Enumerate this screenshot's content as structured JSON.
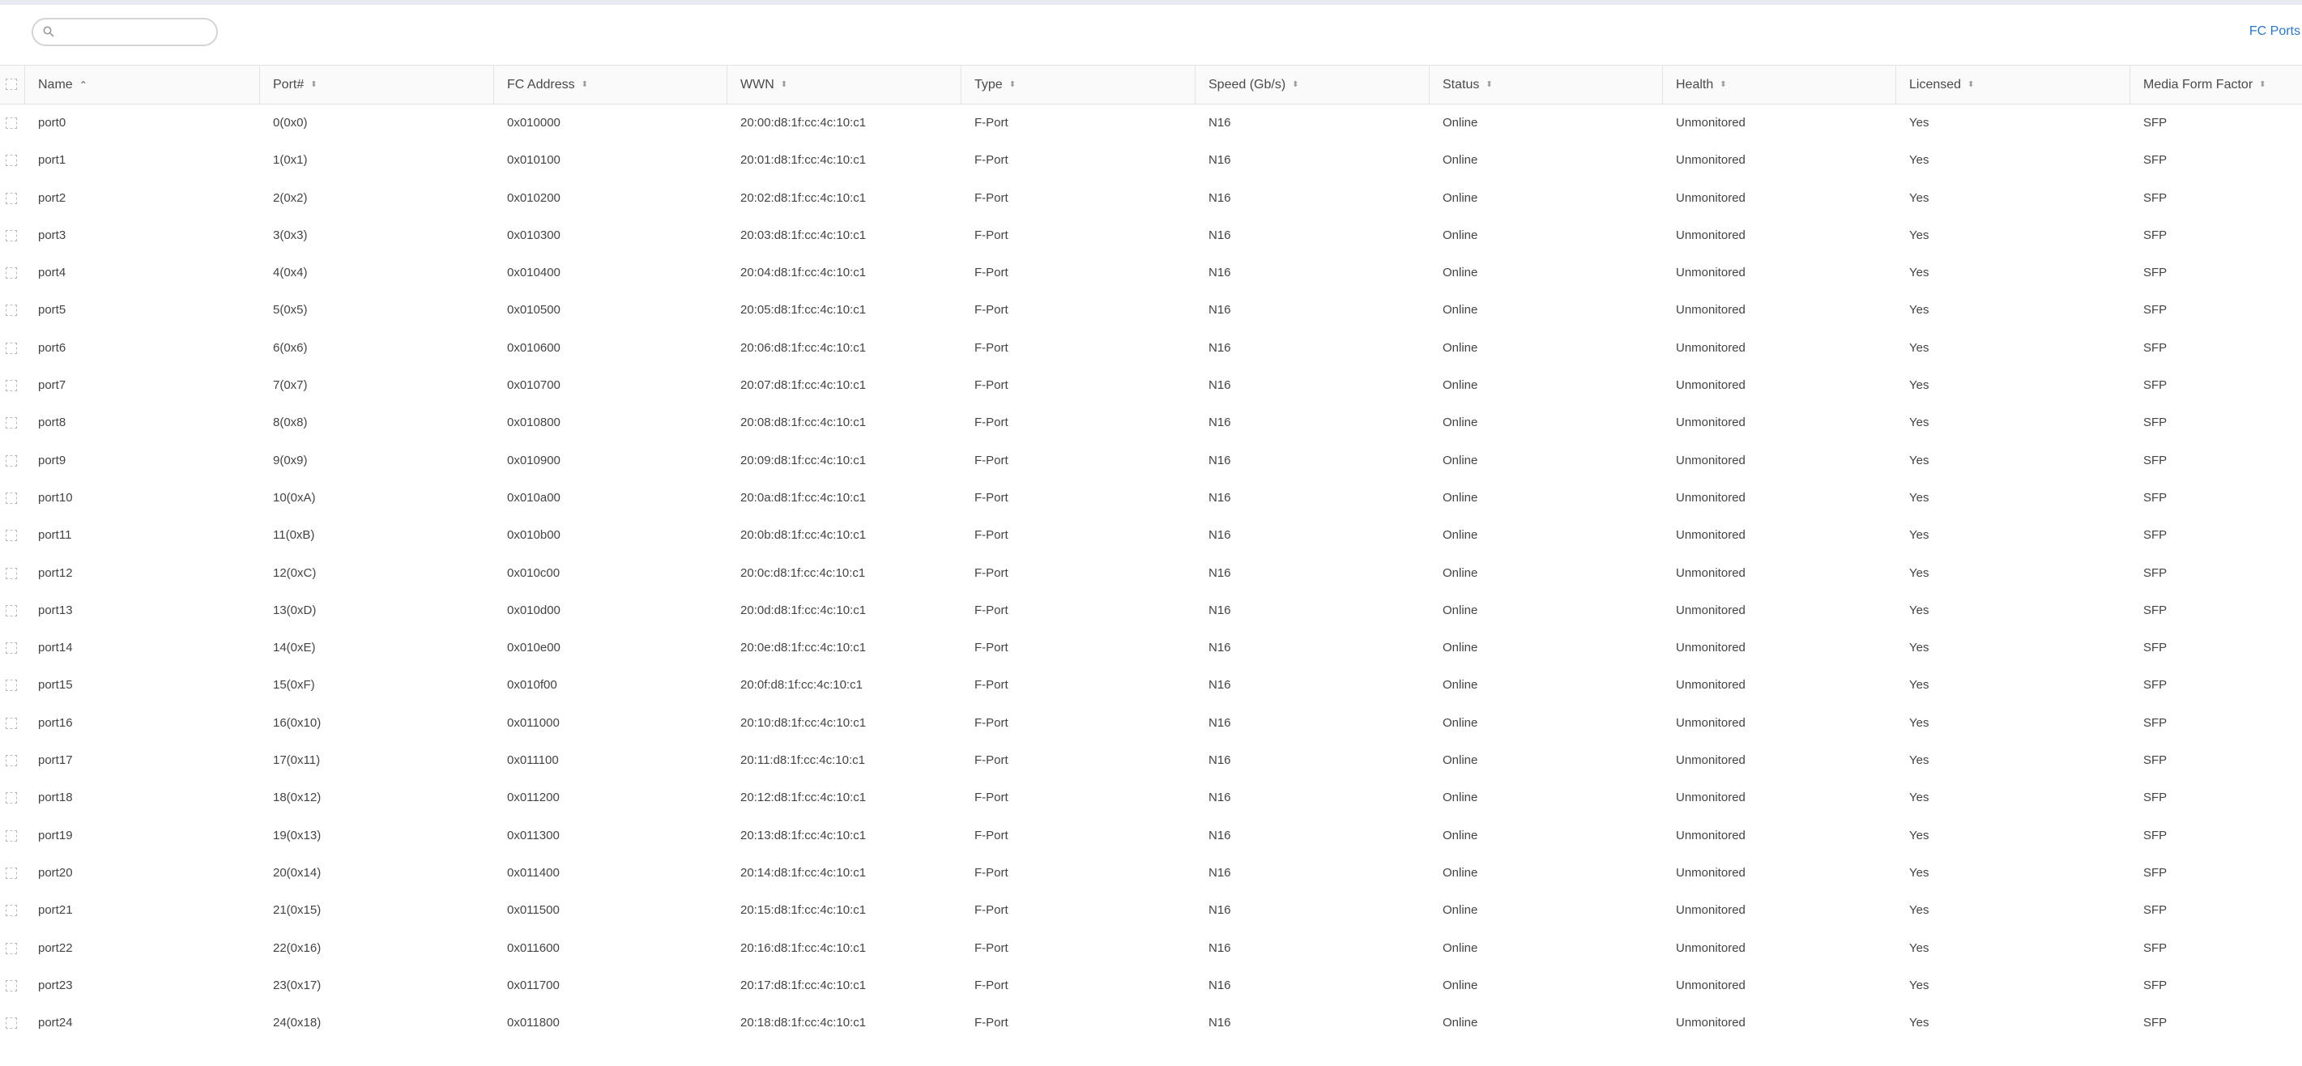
{
  "search": {
    "value": "",
    "placeholder": ""
  },
  "nav": {
    "fc_ports_label": "FC Ports"
  },
  "columns": [
    {
      "key": "name",
      "label": "Name",
      "sort": "asc"
    },
    {
      "key": "port",
      "label": "Port#",
      "sort": "none"
    },
    {
      "key": "fc",
      "label": "FC Address",
      "sort": "none"
    },
    {
      "key": "wwn",
      "label": "WWN",
      "sort": "none"
    },
    {
      "key": "type",
      "label": "Type",
      "sort": "none"
    },
    {
      "key": "speed",
      "label": "Speed (Gb/s)",
      "sort": "none"
    },
    {
      "key": "status",
      "label": "Status",
      "sort": "none"
    },
    {
      "key": "health",
      "label": "Health",
      "sort": "none"
    },
    {
      "key": "licensed",
      "label": "Licensed",
      "sort": "none"
    },
    {
      "key": "media",
      "label": "Media Form Factor",
      "sort": "none"
    }
  ],
  "rows": [
    [
      "port0",
      "0(0x0)",
      "0x010000",
      "20:00:d8:1f:cc:4c:10:c1",
      "F-Port",
      "N16",
      "Online",
      "Unmonitored",
      "Yes",
      "SFP"
    ],
    [
      "port1",
      "1(0x1)",
      "0x010100",
      "20:01:d8:1f:cc:4c:10:c1",
      "F-Port",
      "N16",
      "Online",
      "Unmonitored",
      "Yes",
      "SFP"
    ],
    [
      "port2",
      "2(0x2)",
      "0x010200",
      "20:02:d8:1f:cc:4c:10:c1",
      "F-Port",
      "N16",
      "Online",
      "Unmonitored",
      "Yes",
      "SFP"
    ],
    [
      "port3",
      "3(0x3)",
      "0x010300",
      "20:03:d8:1f:cc:4c:10:c1",
      "F-Port",
      "N16",
      "Online",
      "Unmonitored",
      "Yes",
      "SFP"
    ],
    [
      "port4",
      "4(0x4)",
      "0x010400",
      "20:04:d8:1f:cc:4c:10:c1",
      "F-Port",
      "N16",
      "Online",
      "Unmonitored",
      "Yes",
      "SFP"
    ],
    [
      "port5",
      "5(0x5)",
      "0x010500",
      "20:05:d8:1f:cc:4c:10:c1",
      "F-Port",
      "N16",
      "Online",
      "Unmonitored",
      "Yes",
      "SFP"
    ],
    [
      "port6",
      "6(0x6)",
      "0x010600",
      "20:06:d8:1f:cc:4c:10:c1",
      "F-Port",
      "N16",
      "Online",
      "Unmonitored",
      "Yes",
      "SFP"
    ],
    [
      "port7",
      "7(0x7)",
      "0x010700",
      "20:07:d8:1f:cc:4c:10:c1",
      "F-Port",
      "N16",
      "Online",
      "Unmonitored",
      "Yes",
      "SFP"
    ],
    [
      "port8",
      "8(0x8)",
      "0x010800",
      "20:08:d8:1f:cc:4c:10:c1",
      "F-Port",
      "N16",
      "Online",
      "Unmonitored",
      "Yes",
      "SFP"
    ],
    [
      "port9",
      "9(0x9)",
      "0x010900",
      "20:09:d8:1f:cc:4c:10:c1",
      "F-Port",
      "N16",
      "Online",
      "Unmonitored",
      "Yes",
      "SFP"
    ],
    [
      "port10",
      "10(0xA)",
      "0x010a00",
      "20:0a:d8:1f:cc:4c:10:c1",
      "F-Port",
      "N16",
      "Online",
      "Unmonitored",
      "Yes",
      "SFP"
    ],
    [
      "port11",
      "11(0xB)",
      "0x010b00",
      "20:0b:d8:1f:cc:4c:10:c1",
      "F-Port",
      "N16",
      "Online",
      "Unmonitored",
      "Yes",
      "SFP"
    ],
    [
      "port12",
      "12(0xC)",
      "0x010c00",
      "20:0c:d8:1f:cc:4c:10:c1",
      "F-Port",
      "N16",
      "Online",
      "Unmonitored",
      "Yes",
      "SFP"
    ],
    [
      "port13",
      "13(0xD)",
      "0x010d00",
      "20:0d:d8:1f:cc:4c:10:c1",
      "F-Port",
      "N16",
      "Online",
      "Unmonitored",
      "Yes",
      "SFP"
    ],
    [
      "port14",
      "14(0xE)",
      "0x010e00",
      "20:0e:d8:1f:cc:4c:10:c1",
      "F-Port",
      "N16",
      "Online",
      "Unmonitored",
      "Yes",
      "SFP"
    ],
    [
      "port15",
      "15(0xF)",
      "0x010f00",
      "20:0f:d8:1f:cc:4c:10:c1",
      "F-Port",
      "N16",
      "Online",
      "Unmonitored",
      "Yes",
      "SFP"
    ],
    [
      "port16",
      "16(0x10)",
      "0x011000",
      "20:10:d8:1f:cc:4c:10:c1",
      "F-Port",
      "N16",
      "Online",
      "Unmonitored",
      "Yes",
      "SFP"
    ],
    [
      "port17",
      "17(0x11)",
      "0x011100",
      "20:11:d8:1f:cc:4c:10:c1",
      "F-Port",
      "N16",
      "Online",
      "Unmonitored",
      "Yes",
      "SFP"
    ],
    [
      "port18",
      "18(0x12)",
      "0x011200",
      "20:12:d8:1f:cc:4c:10:c1",
      "F-Port",
      "N16",
      "Online",
      "Unmonitored",
      "Yes",
      "SFP"
    ],
    [
      "port19",
      "19(0x13)",
      "0x011300",
      "20:13:d8:1f:cc:4c:10:c1",
      "F-Port",
      "N16",
      "Online",
      "Unmonitored",
      "Yes",
      "SFP"
    ],
    [
      "port20",
      "20(0x14)",
      "0x011400",
      "20:14:d8:1f:cc:4c:10:c1",
      "F-Port",
      "N16",
      "Online",
      "Unmonitored",
      "Yes",
      "SFP"
    ],
    [
      "port21",
      "21(0x15)",
      "0x011500",
      "20:15:d8:1f:cc:4c:10:c1",
      "F-Port",
      "N16",
      "Online",
      "Unmonitored",
      "Yes",
      "SFP"
    ],
    [
      "port22",
      "22(0x16)",
      "0x011600",
      "20:16:d8:1f:cc:4c:10:c1",
      "F-Port",
      "N16",
      "Online",
      "Unmonitored",
      "Yes",
      "SFP"
    ],
    [
      "port23",
      "23(0x17)",
      "0x011700",
      "20:17:d8:1f:cc:4c:10:c1",
      "F-Port",
      "N16",
      "Online",
      "Unmonitored",
      "Yes",
      "SFP"
    ],
    [
      "port24",
      "24(0x18)",
      "0x011800",
      "20:18:d8:1f:cc:4c:10:c1",
      "F-Port",
      "N16",
      "Online",
      "Unmonitored",
      "Yes",
      "SFP"
    ]
  ]
}
